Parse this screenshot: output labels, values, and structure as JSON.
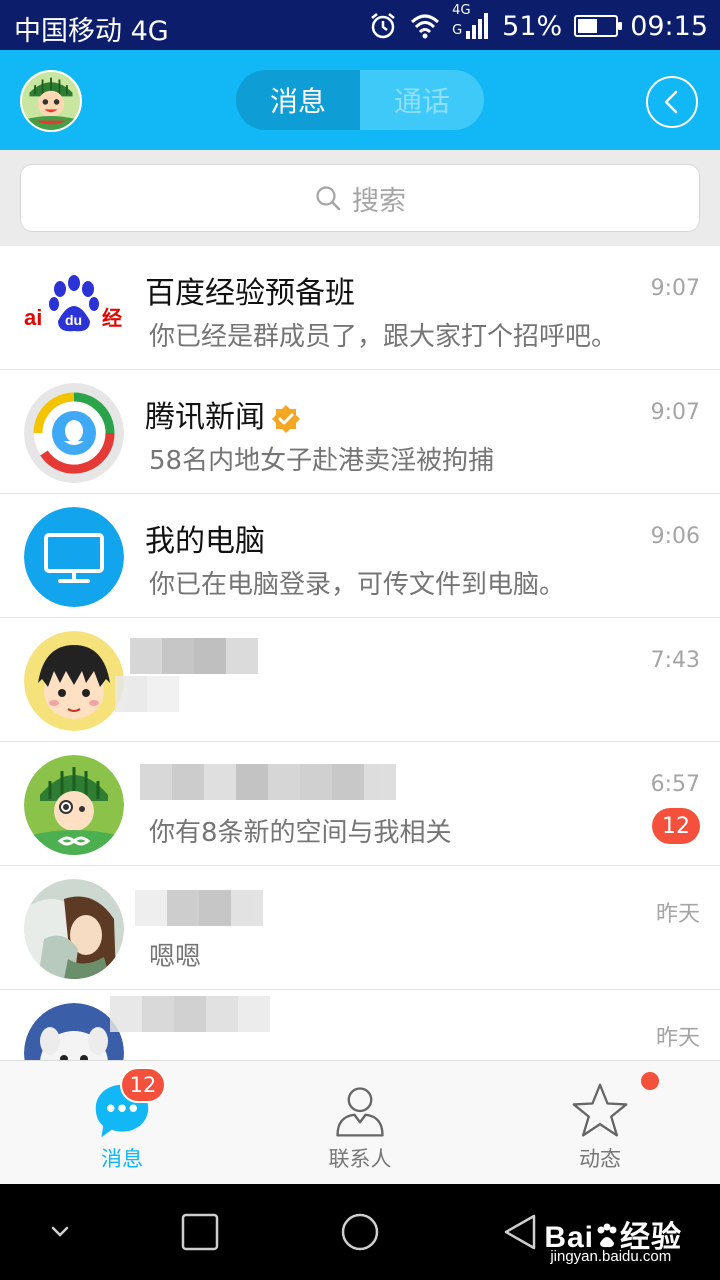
{
  "status_bar": {
    "carrier": "中国移动 4G",
    "network_top": "4G",
    "network_bottom": "G",
    "battery_percent": "51%",
    "battery_level": 0.51,
    "time": "09:15",
    "icons": [
      "alarm-icon",
      "wifi-icon",
      "signal-icon",
      "battery-icon"
    ]
  },
  "header": {
    "tabs": [
      {
        "label": "消息",
        "active": true
      },
      {
        "label": "通话",
        "active": false
      }
    ],
    "back_icon": "chevron-left-icon"
  },
  "search": {
    "placeholder": "搜索",
    "icon": "search-icon"
  },
  "conversations": [
    {
      "name": "百度经验预备班",
      "preview": "你已经是群成员了，跟大家打个招呼吧。",
      "time": "9:07",
      "avatar": "baidu-logo"
    },
    {
      "name": "腾讯新闻",
      "preview": "58名内地女子赴港卖淫被拘捕",
      "time": "9:07",
      "verified": true,
      "avatar": "tencent-news-logo"
    },
    {
      "name": "我的电脑",
      "preview": "你已在电脑登录，可传文件到电脑。",
      "time": "9:06",
      "avatar": "computer-icon"
    },
    {
      "name": "",
      "preview": "",
      "time": "7:43",
      "avatar": "cartoon-girl-avatar"
    },
    {
      "name": "",
      "preview": "你有8条新的空间与我相关",
      "time": "6:57",
      "badge": "12",
      "avatar": "watermelon-kid-avatar"
    },
    {
      "name": "",
      "preview": "嗯嗯",
      "time": "昨天",
      "avatar": "anime-avatar"
    },
    {
      "name": "",
      "preview": "",
      "time": "昨天",
      "avatar": "dog-avatar"
    }
  ],
  "bottom_nav": [
    {
      "label": "消息",
      "icon": "chat-bubble-icon",
      "badge": "12",
      "active": true
    },
    {
      "label": "联系人",
      "icon": "contact-icon",
      "active": false
    },
    {
      "label": "动态",
      "icon": "star-icon",
      "dot": true,
      "active": false
    }
  ],
  "watermark": {
    "brand": "Bai",
    "brand_suffix": "经验",
    "url": "jingyan.baidu.com"
  },
  "colors": {
    "header_blue": "#12b7f5",
    "status_bar": "#0b1d6b",
    "badge_red": "#f4503b",
    "verified_orange": "#f5a623"
  }
}
